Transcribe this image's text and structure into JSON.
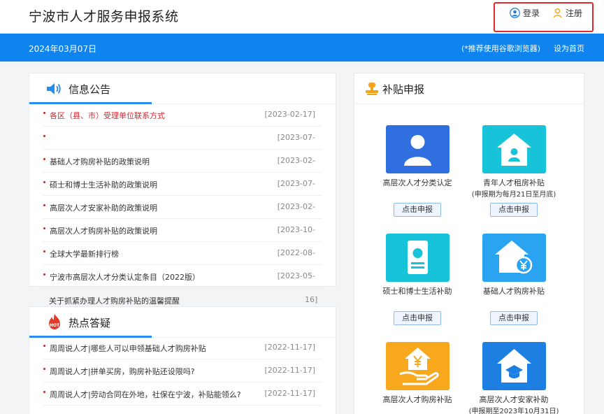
{
  "header": {
    "site_title": "宁波市人才服务申报系统",
    "login_label": "登录",
    "register_label": "注册"
  },
  "infobar": {
    "date": "2024年03月07日",
    "browser_tip": "(*推荐使用谷歌浏览器)",
    "set_home": "设为首页"
  },
  "notices": {
    "title": "信息公告",
    "items": [
      {
        "text": "各区（县、市）受理单位联系方式",
        "date": "[2023-02-17]"
      },
      {
        "text": "",
        "date": "[2023-07-"
      },
      {
        "text": "基础人才购房补贴的政策说明",
        "date": "[2023-02-"
      },
      {
        "text": "硕士和博士生活补助的政策说明",
        "date": "[2023-07-"
      },
      {
        "text": "高层次人才安家补助的政策说明",
        "date": "[2023-02-"
      },
      {
        "text": "高层次人才购房补贴的政策说明",
        "date": "[2023-10-"
      },
      {
        "text": "全球大学最新排行榜",
        "date": "[2022-08-"
      },
      {
        "text": "宁波市高层次人才分类认定条目（2022版）",
        "date": "[2023-05-"
      }
    ],
    "overflow_text": "关于抓紧办理人才购房补贴的温馨提醒",
    "overflow_date": "16]"
  },
  "faq": {
    "title": "热点答疑",
    "items": [
      {
        "text": "周周说人才|哪些人可以申领基础人才购房补贴",
        "date": "[2022-11-17]"
      },
      {
        "text": "周周说人才|拼单买房，购房补贴还设限吗?",
        "date": "[2022-11-17]"
      },
      {
        "text": "周周说人才|劳动合同在外地，社保在宁波，补贴能领么?",
        "date": "[2022-11-17]"
      }
    ]
  },
  "subsidy": {
    "title": "补贴申报",
    "apply_label": "点击申报",
    "tiles": [
      {
        "label": "高层次人才分类认定",
        "sub": "",
        "icon": "person-icon",
        "color": "#2f6fe0"
      },
      {
        "label": "青年人才租房补贴",
        "sub": "(申报期为每月21日至月底)",
        "icon": "house-person-icon",
        "color": "#16c3d9"
      },
      {
        "label": "硕士和博士生活补助",
        "sub": "",
        "icon": "certificate-icon",
        "color": "#16c3d9"
      },
      {
        "label": "基础人才购房补贴",
        "sub": "",
        "icon": "house-yen-icon",
        "color": "#2aa3f0"
      },
      {
        "label": "高层次人才购房补贴",
        "sub": "",
        "icon": "hand-yen-icon",
        "color": "#f7a81d"
      },
      {
        "label": "高层次人才安家补助",
        "sub": "(申报期至2023年10月31日)",
        "icon": "house-cap-icon",
        "color": "#1e7fe3"
      }
    ]
  }
}
